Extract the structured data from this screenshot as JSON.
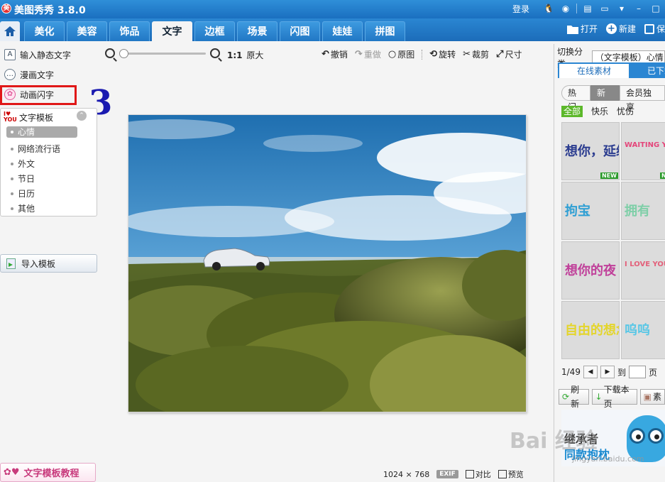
{
  "titlebar": {
    "title": "美图秀秀 3.8.0",
    "login": "登录"
  },
  "tabs": [
    "美化",
    "美容",
    "饰品",
    "文字",
    "边框",
    "场景",
    "闪图",
    "娃娃",
    "拼图"
  ],
  "active_tab": "文字",
  "header_actions": {
    "open": "打开",
    "new": "新建",
    "save": "保"
  },
  "left_menu": {
    "static_text": "输入静态文字",
    "comic_text": "漫画文字",
    "animated_text": "动画闪字",
    "template_label": "文字模板",
    "template_items": [
      "心情",
      "网络流行语",
      "外文",
      "节日",
      "日历",
      "其他"
    ],
    "import_template": "导入模板",
    "tutorial": "文字模板教程"
  },
  "step_marker": "3",
  "toolbar": {
    "zoom_ratio": "1:1",
    "original_size": "原大",
    "undo": "撤销",
    "redo": "重做",
    "original": "原图",
    "rotate": "旋转",
    "crop": "裁剪",
    "size": "尺寸"
  },
  "status": {
    "width": "1024",
    "times": "×",
    "height": "768",
    "exif": "EXIF",
    "compare": "对比",
    "preview": "预览"
  },
  "right_panel": {
    "category_label": "切换分类",
    "category_value": "（文字模板）心情",
    "tab_online": "在线素材",
    "tab_downloaded": "已下载",
    "filters": [
      "热门",
      "新鲜",
      "会员独享"
    ],
    "active_filter": "新鲜",
    "subfilters": [
      "全部",
      "快乐",
      "忧伤"
    ],
    "active_subfilter": "全部",
    "thumbnails": [
      {
        "text": "想你，延续",
        "color": "#2a3b8f",
        "new": "NEW"
      },
      {
        "text": "WAITING YOU",
        "color": "#e4457a",
        "new": "NEW"
      },
      {
        "text": "拘宝",
        "color": "#2f9fd4",
        "new": ""
      },
      {
        "text": "拥有",
        "color": "#7fcfa8",
        "new": ""
      },
      {
        "text": "想你的夜",
        "color": "#c0409a",
        "new": ""
      },
      {
        "text": "I LOVE YOU",
        "color": "#e3607a",
        "new": ""
      },
      {
        "text": "自由的想念",
        "color": "#e4d52c",
        "new": ""
      },
      {
        "text": "呜呜",
        "color": "#5ac7e6",
        "new": ""
      }
    ],
    "pager": {
      "current": "1/49",
      "goto": "到",
      "page": "页"
    },
    "btn_refresh": "刷新",
    "btn_download": "下载本页",
    "btn_more": "素",
    "banner_line1": "继承者",
    "banner_line2": "同款抱枕"
  },
  "watermark": "Bai 经验",
  "watermark_url": "jingyan.baidu.com"
}
